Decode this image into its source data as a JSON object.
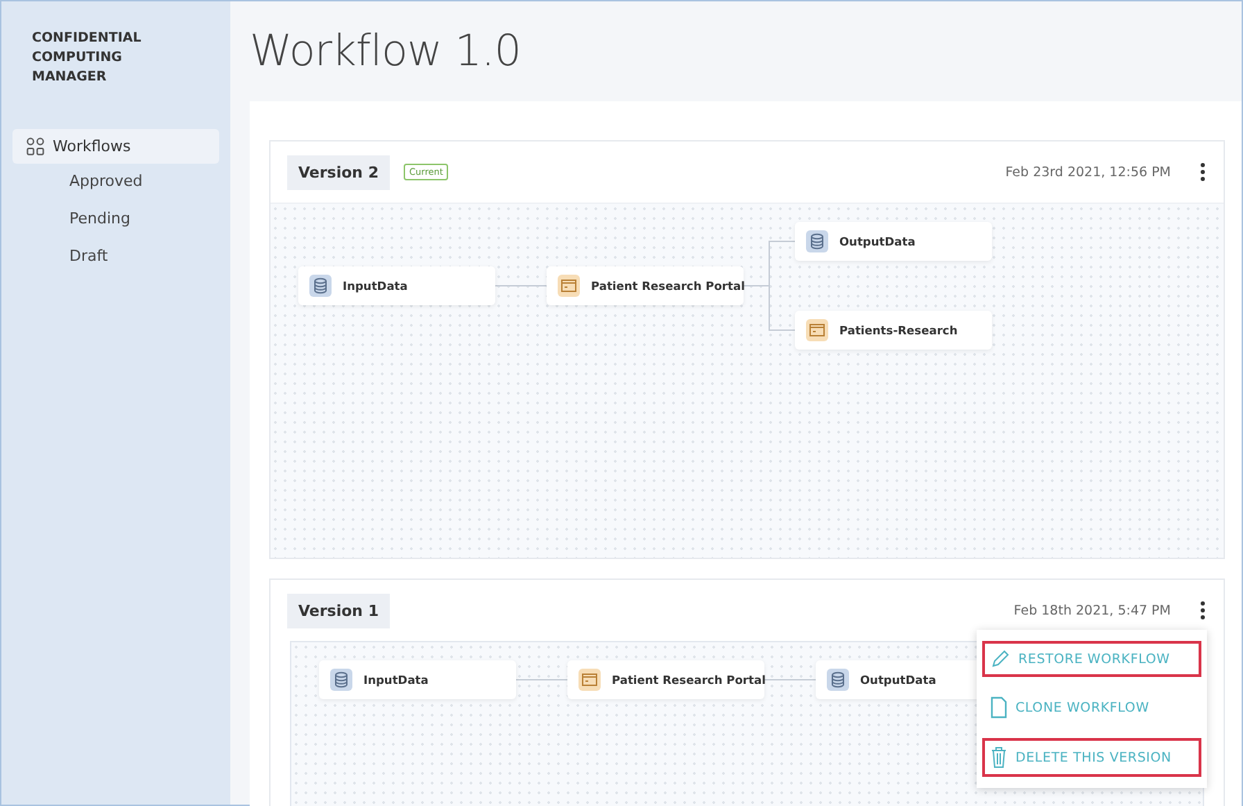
{
  "sidebar": {
    "brand": "CONFIDENTIAL COMPUTING MANAGER",
    "items": [
      {
        "label": "Workflows",
        "selected": true,
        "children": [
          {
            "label": "Approved",
            "selected": false
          },
          {
            "label": "Pending",
            "selected": false
          },
          {
            "label": "Draft",
            "selected": false
          }
        ]
      }
    ]
  },
  "page": {
    "title": "Workflow 1.0"
  },
  "versions": [
    {
      "name": "Version 2",
      "badge": "Current",
      "date": "Feb 23rd 2021, 12:56 PM",
      "graph": [
        {
          "label": "InputData",
          "kind": "data",
          "children": [
            {
              "label": "Patient Research Portal",
              "kind": "app",
              "children": [
                {
                  "label": "OutputData",
                  "kind": "data"
                },
                {
                  "label": "Patients-Research",
                  "kind": "app"
                }
              ]
            }
          ]
        }
      ]
    },
    {
      "name": "Version 1",
      "date": "Feb 18th 2021, 5:47 PM",
      "graph": [
        {
          "label": "InputData",
          "kind": "data",
          "children": [
            {
              "label": "Patient Research Portal",
              "kind": "app",
              "children": [
                {
                  "label": "OutputData",
                  "kind": "data"
                }
              ]
            }
          ]
        }
      ],
      "menu": [
        {
          "label": "RESTORE WORKFLOW",
          "kind": "edit",
          "highlighted": true
        },
        {
          "label": "CLONE WORKFLOW",
          "kind": "copy",
          "highlighted": false
        },
        {
          "label": "DELETE THIS VERSION",
          "kind": "delete",
          "highlighted": true
        }
      ]
    }
  ]
}
